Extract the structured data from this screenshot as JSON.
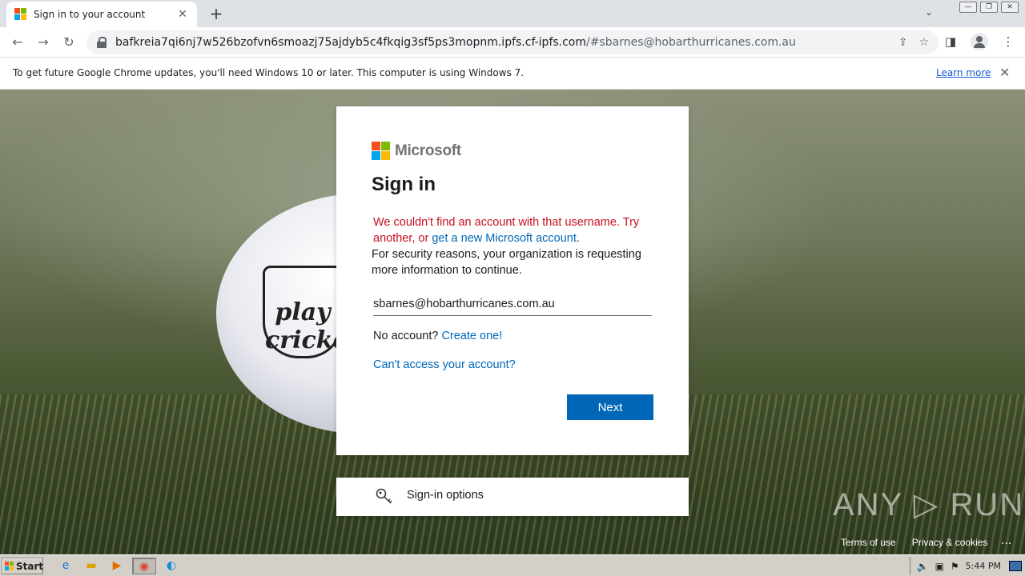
{
  "browser": {
    "tab_title": "Sign in to your account",
    "tab_close": "✕",
    "new_tab": "+",
    "url_host": "bafkreia7qi6nj7w526bzofvn6smoazj75ajdyb5c4fkqig3sf5ps3mopnm.ipfs.cf-ipfs.com",
    "url_rest": "/#sbarnes@hobarthurricanes.com.au"
  },
  "infobar": {
    "message": "To get future Google Chrome updates, you'll need Windows 10 or later. This computer is using Windows 7.",
    "learn_more": "Learn more",
    "close": "✕"
  },
  "login": {
    "brand": "Microsoft",
    "title": "Sign in",
    "error_text": "We couldn't find an account with that username. Try another, or ",
    "error_link": "get a new Microsoft account",
    "error_end": ".",
    "security_text": "For security reasons, your organization is requesting more information to continue.",
    "email_value": "sbarnes@hobarthurricanes.com.au",
    "no_account": "No account? ",
    "create_one": "Create one!",
    "cant_access": "Can't access your account?",
    "next_label": "Next",
    "signin_options": "Sign-in options"
  },
  "background": {
    "ball_text": "play cricket",
    "watermark": "ANY ▷ RUN"
  },
  "footer": {
    "terms": "Terms of use",
    "privacy": "Privacy & cookies",
    "more": "..."
  },
  "taskbar": {
    "start_label": "Start",
    "clock": "5:44 PM"
  },
  "colors": {
    "accent": "#0067b8",
    "error": "#c50f1f"
  }
}
